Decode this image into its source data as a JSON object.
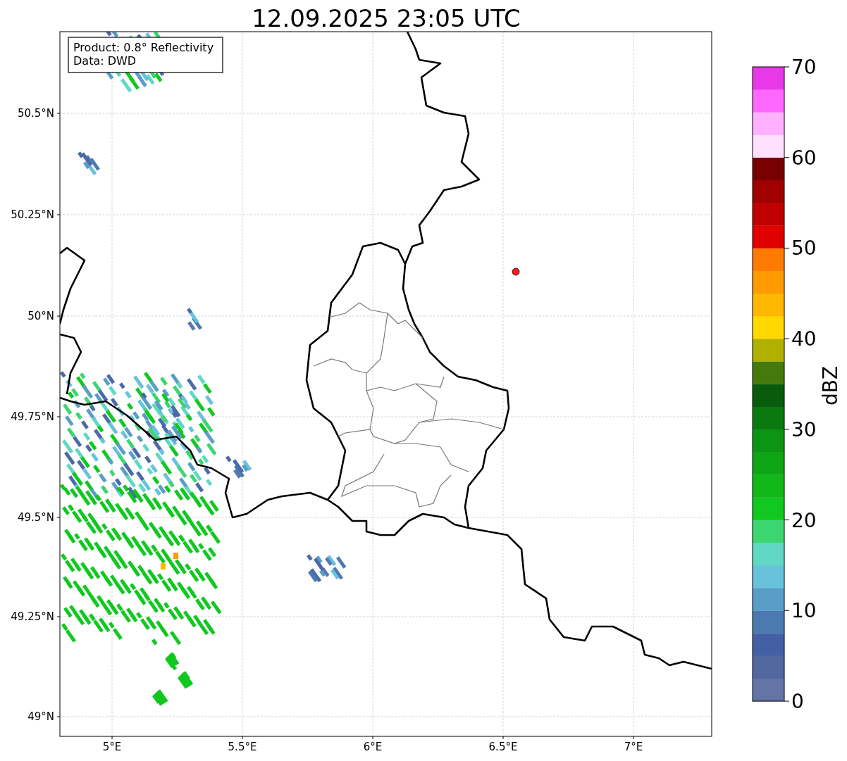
{
  "title": "12.09.2025 23:05 UTC",
  "annotation": {
    "lines": [
      "Product: 0.8° Reflectivity",
      "Data: DWD"
    ]
  },
  "x_axis": {
    "ticks": [
      "5°E",
      "5.5°E",
      "6°E",
      "6.5°E",
      "7°E"
    ]
  },
  "y_axis": {
    "ticks": [
      "50.5°N",
      "50.25°N",
      "50°N",
      "49.75°N",
      "49.5°N",
      "49.25°N",
      "49°N"
    ]
  },
  "colorbar": {
    "label": "dBZ",
    "ticks": [
      "70",
      "60",
      "50",
      "40",
      "30",
      "20",
      "10",
      "0"
    ],
    "segments": [
      {
        "color": "#6574a6"
      },
      {
        "color": "#5468a0"
      },
      {
        "color": "#4460a4"
      },
      {
        "color": "#4a7ab0"
      },
      {
        "color": "#5a9ec8"
      },
      {
        "color": "#68c2dc"
      },
      {
        "color": "#60d8c4"
      },
      {
        "color": "#3cd670"
      },
      {
        "color": "#10c820"
      },
      {
        "color": "#10b818"
      },
      {
        "color": "#0ea614"
      },
      {
        "color": "#0c9414"
      },
      {
        "color": "#0a7a10"
      },
      {
        "color": "#085c0c"
      },
      {
        "color": "#447a0c"
      },
      {
        "color": "#b0b000"
      },
      {
        "color": "#ffd800"
      },
      {
        "color": "#ffb800"
      },
      {
        "color": "#ff9a00"
      },
      {
        "color": "#ff7a00"
      },
      {
        "color": "#e00000"
      },
      {
        "color": "#c00000"
      },
      {
        "color": "#a00000"
      },
      {
        "color": "#780000"
      },
      {
        "color": "#ffe0ff"
      },
      {
        "color": "#ffb0ff"
      },
      {
        "color": "#ff68ff"
      },
      {
        "color": "#e838e8"
      }
    ]
  }
}
